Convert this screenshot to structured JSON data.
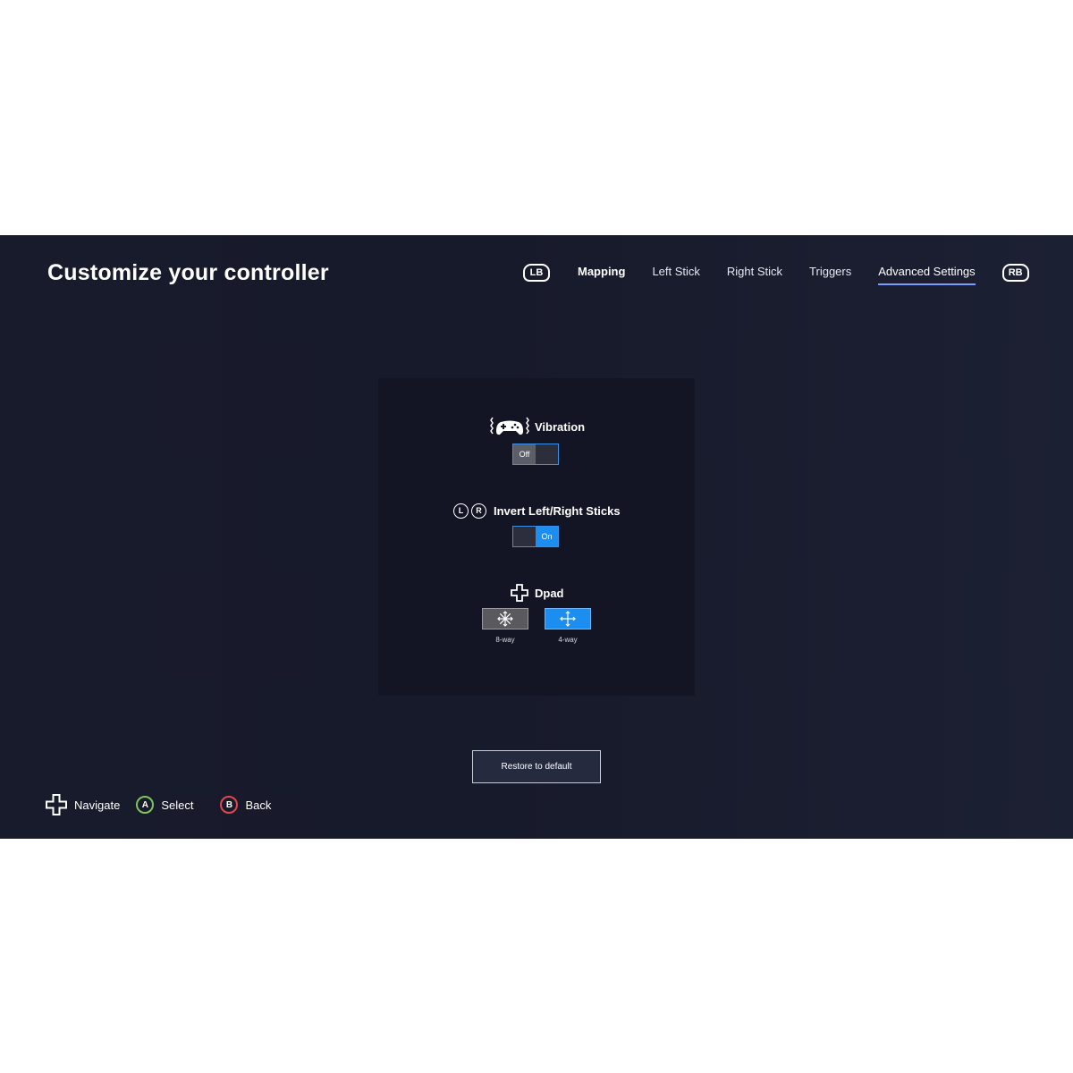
{
  "header": {
    "title": "Customize your controller"
  },
  "tabs": {
    "left_bumper": "LB",
    "right_bumper": "RB",
    "items": [
      {
        "label": "Mapping"
      },
      {
        "label": "Left Stick"
      },
      {
        "label": "Right Stick"
      },
      {
        "label": "Triggers"
      },
      {
        "label": "Advanced Settings"
      }
    ],
    "active": "Advanced Settings"
  },
  "settings": {
    "vibration": {
      "label": "Vibration",
      "icon": "controller-vibration-icon",
      "state_label": "Off",
      "value": "off"
    },
    "invert_sticks": {
      "label": "Invert Left/Right Sticks",
      "left_glyph": "L",
      "right_glyph": "R",
      "state_label": "On",
      "value": "on"
    },
    "dpad": {
      "label": "Dpad",
      "icon": "dpad-icon",
      "options": [
        {
          "label": "8-way",
          "icon": "eight-way-arrows-icon"
        },
        {
          "label": "4-way",
          "icon": "four-way-arrows-icon"
        }
      ],
      "selected": "4-way"
    }
  },
  "restore_button": {
    "label": "Restore to default"
  },
  "footer": {
    "navigate_label": "Navigate",
    "select_glyph": "A",
    "select_label": "Select",
    "back_glyph": "B",
    "back_label": "Back"
  },
  "colors": {
    "background": "#181b2c",
    "panel": "#131524",
    "accent_blue": "#1b8ef0",
    "tab_underline": "#7a9cff",
    "button_a": "#7fc45c",
    "button_b": "#e0474c"
  }
}
